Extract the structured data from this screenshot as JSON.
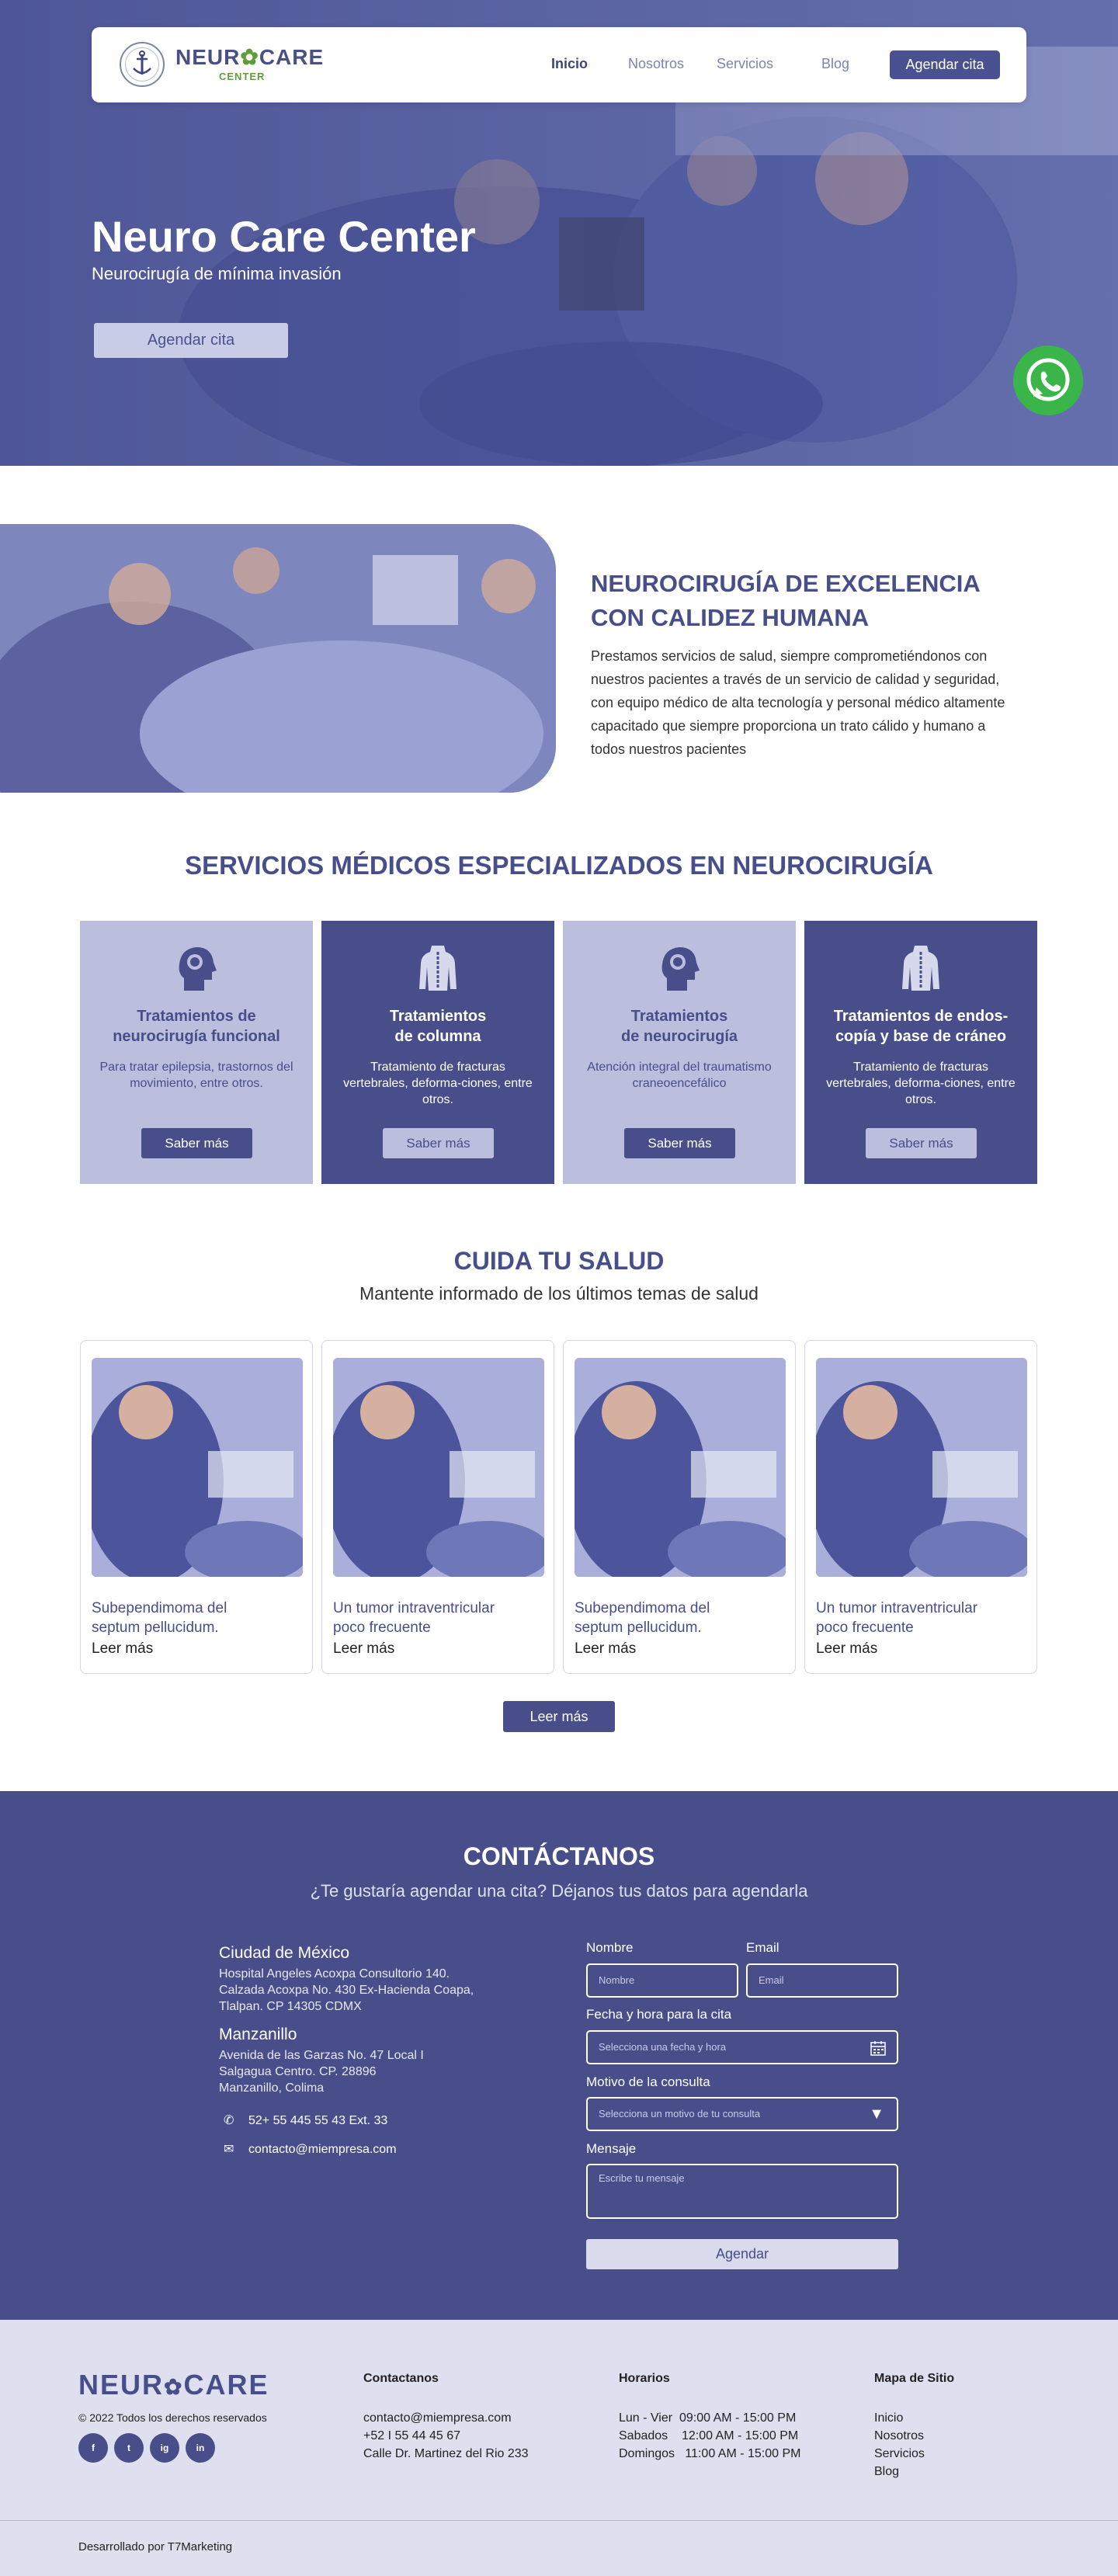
{
  "brand": {
    "name_left": "NEUR",
    "name_right": "CARE",
    "sub": "CENTER"
  },
  "nav": {
    "items": [
      {
        "label": "Inicio",
        "active": true
      },
      {
        "label": "Nosotros",
        "active": false
      },
      {
        "label": "Servicios",
        "active": false
      },
      {
        "label": "Blog",
        "active": false
      }
    ],
    "cta_label": "Agendar cita"
  },
  "hero": {
    "title": "Neuro Care Center",
    "subtitle": "Neurocirugía de mínima invasión",
    "cta_label": "Agendar cita",
    "whatsapp_icon": "whatsapp-icon"
  },
  "about": {
    "title_line1": "NEUROCIRUGÍA DE EXCELENCIA",
    "title_line2": "CON CALIDEZ HUMANA",
    "text": "Prestamos servicios de salud, siempre comprometiéndonos con nuestros pacientes a través de un servicio de calidad y seguridad, con equipo médico de alta tecnología y personal médico altamente capacitado que siempre proporciona un trato cálido y humano a todos nuestros pacientes"
  },
  "services": {
    "title": "SERVICIOS MÉDICOS ESPECIALIZADOS EN NEUROCIRUGÍA",
    "items": [
      {
        "title_l1": "Tratamientos de",
        "title_l2": "neurocirugía funcional",
        "desc": "Para tratar epilepsia, trastornos del movimiento, entre otros.",
        "button": "Saber más",
        "icon": "brain-head-icon"
      },
      {
        "title_l1": "Tratamientos",
        "title_l2": "de columna",
        "desc": "Tratamiento de fracturas vertebrales, deforma-ciones, entre otros.",
        "button": "Saber más",
        "icon": "spine-torso-icon"
      },
      {
        "title_l1": "Tratamientos",
        "title_l2": "de neurocirugía",
        "desc": "Atención integral del traumatismo craneoencefálico",
        "button": "Saber más",
        "icon": "brain-head-icon"
      },
      {
        "title_l1": "Tratamientos de endos-",
        "title_l2": "copía y base de cráneo",
        "desc": "Tratamiento de fracturas vertebrales, deforma-ciones, entre otros.",
        "button": "Saber más",
        "icon": "spine-torso-icon"
      }
    ]
  },
  "blog": {
    "title": "CUIDA TU SALUD",
    "subtitle": "Mantente informado de los últimos temas de salud",
    "posts": [
      {
        "title_l1": "Subependimoma del",
        "title_l2": "septum pellucidum.",
        "link": "Leer más"
      },
      {
        "title_l1": "Un tumor intraventricular",
        "title_l2": "poco frecuente",
        "link": "Leer más"
      },
      {
        "title_l1": "Subependimoma del",
        "title_l2": "septum pellucidum.",
        "link": "Leer más"
      },
      {
        "title_l1": "Un tumor intraventricular",
        "title_l2": "poco frecuente",
        "link": "Leer más"
      }
    ],
    "more_label": "Leer más"
  },
  "contact": {
    "title": "CONTÁCTANOS",
    "subtitle": "¿Te gustaría agendar una cita?  Déjanos tus datos para agendarla",
    "loc1": {
      "name": "Ciudad de México",
      "l1": "Hospital Angeles Acoxpa Consultorio 140.",
      "l2": "Calzada Acoxpa No. 430 Ex-Hacienda Coapa,",
      "l3": "Tlalpan. CP 14305 CDMX"
    },
    "loc2": {
      "name": "Manzanillo",
      "l1": "Avenida de las Garzas No. 47 Local I",
      "l2": "Salgagua Centro. CP. 28896",
      "l3": "Manzanillo, Colima"
    },
    "phone": "52+ 55 445 55 43 Ext. 33",
    "email": "contacto@miempresa.com",
    "form": {
      "name_label": "Nombre",
      "name_placeholder": "Nombre",
      "email_label": "Email",
      "email_placeholder": "Email",
      "date_label": "Fecha y hora para la cita",
      "date_placeholder": "Selecciona una fecha y hora",
      "reason_label": "Motivo de la consulta",
      "reason_placeholder": "Selecciona un motivo de tu consulta",
      "message_label": "Mensaje",
      "message_placeholder": "Escribe tu mensaje",
      "submit_label": "Agendar"
    }
  },
  "footer": {
    "logo_left": "NEUR",
    "logo_right": "CARE",
    "copyright": "© 2022 Todos los derechos reservados",
    "social": [
      "f",
      "t",
      "ig",
      "in"
    ],
    "contact_h": "Contactanos",
    "contact_lines": [
      "contacto@miempresa.com",
      "+52 I 55 44 45 67",
      "Calle Dr. Martinez del Rio 233"
    ],
    "hours_h": "Horarios",
    "hours": [
      {
        "day": "Lun - Vier",
        "time": "09:00 AM - 15:00 PM"
      },
      {
        "day": "Sabados",
        "time": "12:00 AM - 15:00 PM"
      },
      {
        "day": "Domingos",
        "time": "11:00 AM - 15:00 PM"
      }
    ],
    "sitemap_h": "Mapa de Sitio",
    "sitemap": [
      "Inicio",
      "Nosotros",
      "Servicios",
      "Blog"
    ],
    "developed_by": "Desarrollado por T7Marketing"
  },
  "colors": {
    "primary": "#474e8a",
    "light": "#bbbedd",
    "accent_green": "#5f9c3a",
    "whatsapp": "#39b54a"
  }
}
